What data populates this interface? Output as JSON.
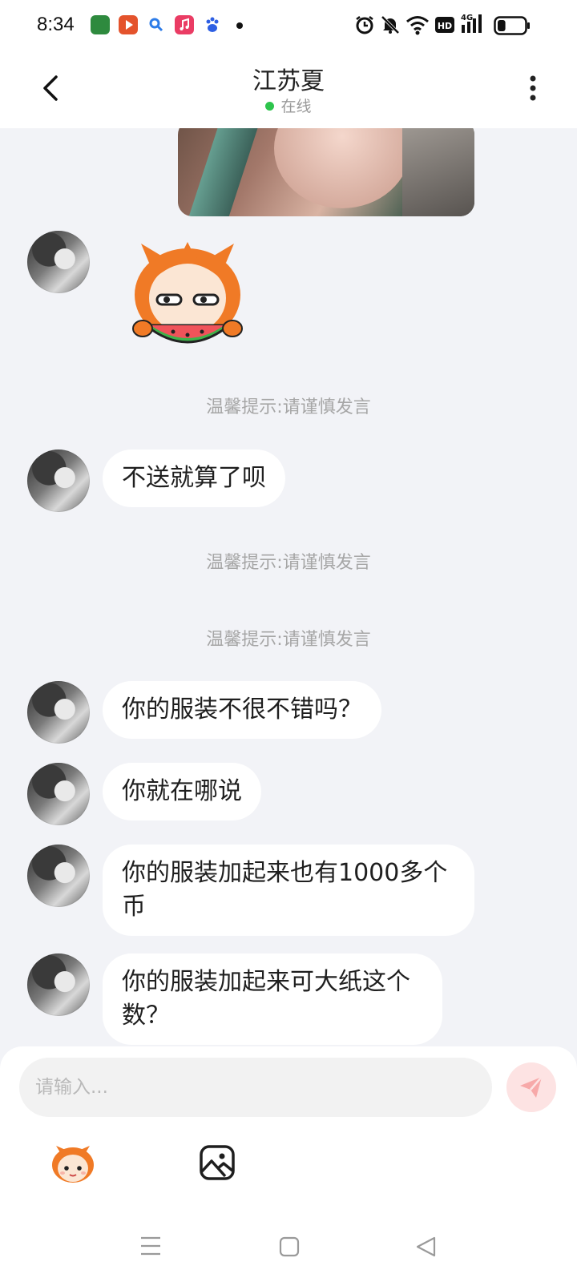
{
  "status_bar": {
    "time": "8:34",
    "app_icons": [
      "reader-app-icon",
      "video-app-icon",
      "search-app-icon",
      "music-app-icon",
      "baidu-app-icon"
    ],
    "system_icons": [
      "alarm-icon",
      "mute-icon",
      "wifi-icon",
      "hd-icon",
      "signal-4g-icon",
      "battery-icon"
    ],
    "hd_label": "HD",
    "network_label": "4G",
    "battery_level": 0.3
  },
  "header": {
    "name": "江苏夏",
    "status": "在线",
    "status_color": "#2dc44c"
  },
  "messages": [
    {
      "type": "image",
      "side": "right"
    },
    {
      "type": "sticker",
      "side": "left",
      "icon": "watermelon-sticker"
    },
    {
      "type": "notice",
      "text": "温馨提示:请谨慎发言"
    },
    {
      "type": "text",
      "side": "left",
      "text": "不送就算了呗"
    },
    {
      "type": "notice",
      "text": "温馨提示:请谨慎发言"
    },
    {
      "type": "notice",
      "text": "温馨提示:请谨慎发言"
    },
    {
      "type": "text",
      "side": "left",
      "text": "你的服装不很不错吗？"
    },
    {
      "type": "text",
      "side": "left",
      "text": "你就在哪说"
    },
    {
      "type": "text",
      "side": "left",
      "text": "你的服装加起来也有1000多个币"
    },
    {
      "type": "text",
      "side": "left",
      "text": "你的服装加起来可大纸这个数？"
    }
  ],
  "input": {
    "placeholder": "请输入...",
    "value": ""
  },
  "toolbar": {
    "buttons": [
      "emoji-icon",
      "image-icon"
    ]
  },
  "colors": {
    "chat_background": "#f2f3f7",
    "bubble": "#ffffff",
    "send_button": "#fde3e3",
    "send_icon": "#f7a9a9"
  }
}
